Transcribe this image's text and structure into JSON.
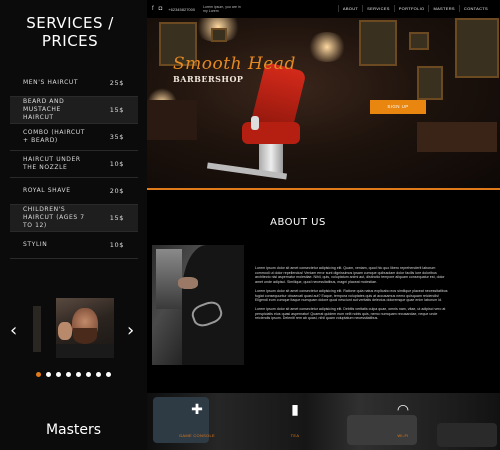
{
  "services": {
    "title": "SERVICES / PRICES",
    "items": [
      {
        "name": "MEN'S HAIRCUT",
        "price": "25$"
      },
      {
        "name": "BEARD AND MUSTACHE HAIRCUT",
        "price": "15$"
      },
      {
        "name": "COMBO (HAIRCUT + BEARD)",
        "price": "35$"
      },
      {
        "name": "HAIRCUT UNDER THE NOZZLE",
        "price": "10$"
      },
      {
        "name": "ROYAL SHAVE",
        "price": "20$"
      },
      {
        "name": "CHILDREN'S HAIRCUT (AGES 7 TO 12)",
        "price": "15$"
      },
      {
        "name": "STYLIN",
        "price": "10$"
      }
    ]
  },
  "carousel": {
    "prev": "‹",
    "next": "›",
    "dot_count": 8,
    "active_dot": 0
  },
  "masters_title": "Masters",
  "nav": {
    "phone": "+62345827000",
    "address": "Lorem ipsum, you are in my Lorem",
    "menu": [
      "ABOUT",
      "SERVICES",
      "PORTFOLIO",
      "MASTERS",
      "CONTACTS"
    ]
  },
  "hero": {
    "title": "Smooth Head",
    "subtitle": "BARBERSHOP",
    "cta": "SIGN UP"
  },
  "about": {
    "title": "ABOUT US",
    "paragraphs": [
      "Lorem ipsum dolor sit amet consectetur adipisicing elit. Quam, veniam, quod hic quo libero reprehenderit laborum commodi ut dolor repellendus! Veniam error sunt dignissimos ipsam cumque quibusdam dolor facilis iure doloribus architecto nisi aspernatur molestiae. Nihil, quis, voluptatum animi aut, distinctio tempore aliquam consequatur est, dolor amet unde adipisci. Similique, quod necessitatibus, magni placeat molestiae.",
      "Lorem ipsum dolor sit amet consectetur adipisicing elit. Ratione quia natus explicabo eos similique placeat necessitatibus fugiat consequuntur obcaecati quasi aut? Eaque, tempora voluptates quis at accusamus nemo quisquam reiciendis! Eligendi eum cumque itaque numquam dolore quod nesciunt aut veritatis delectus doloremque quae enim laborum id.",
      "Lorem ipsum dolor sit amet consectetur adipisicing elit. Debitis veritatis culpa quae, omnis nam, vitae, ut adipisci vero at perspiciatis eius quasi aspernatur! Quaerat quidem eum velit nobis quis, nemo numquam recusandae, neque unde reiciendis ipsum. Deleniti rem ab quasi, nihil quam voluptatum necessitatibus."
    ]
  },
  "features": [
    {
      "icon": "gamepad-icon",
      "glyph": "✚",
      "label": "GAME CONSOLE"
    },
    {
      "icon": "drink-icon",
      "glyph": "▮",
      "label": "TEA"
    },
    {
      "icon": "wifi-icon",
      "glyph": "◠",
      "label": "WI-FI"
    }
  ],
  "colors": {
    "accent": "#e8860f",
    "hero_title": "#e58a22",
    "background": "#000000",
    "panel": "#0b0b0b"
  }
}
